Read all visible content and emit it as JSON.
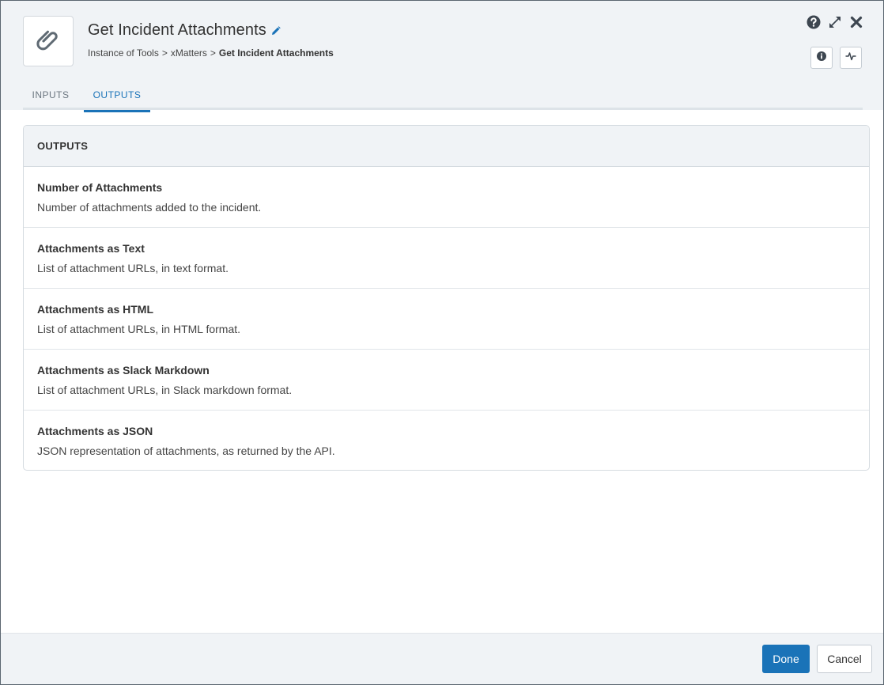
{
  "header": {
    "title": "Get Incident Attachments",
    "step_icon": "paperclip-icon",
    "breadcrumb": {
      "crumbs": [
        "Instance of Tools",
        "xMatters"
      ],
      "separator": ">",
      "current": "Get Incident Attachments"
    },
    "actions": [
      "help-icon",
      "expand-icon",
      "close-icon"
    ],
    "small_buttons": [
      "info-icon",
      "activity-icon"
    ]
  },
  "tabs": [
    {
      "label": "INPUTS",
      "active": false
    },
    {
      "label": "OUTPUTS",
      "active": true
    }
  ],
  "outputs": {
    "heading": "OUTPUTS",
    "items": [
      {
        "name": "Number of Attachments",
        "description": "Number of attachments added to the incident."
      },
      {
        "name": "Attachments as Text",
        "description": "List of attachment URLs, in text format."
      },
      {
        "name": "Attachments as HTML",
        "description": "List of attachment URLs, in HTML format."
      },
      {
        "name": "Attachments as Slack Markdown",
        "description": "List of attachment URLs, in Slack markdown format."
      },
      {
        "name": "Attachments as JSON",
        "description": "JSON representation of attachments, as returned by the API."
      }
    ]
  },
  "footer": {
    "done_label": "Done",
    "cancel_label": "Cancel"
  },
  "colors": {
    "accent": "#1a73b8",
    "header_bg": "#f0f3f6"
  }
}
